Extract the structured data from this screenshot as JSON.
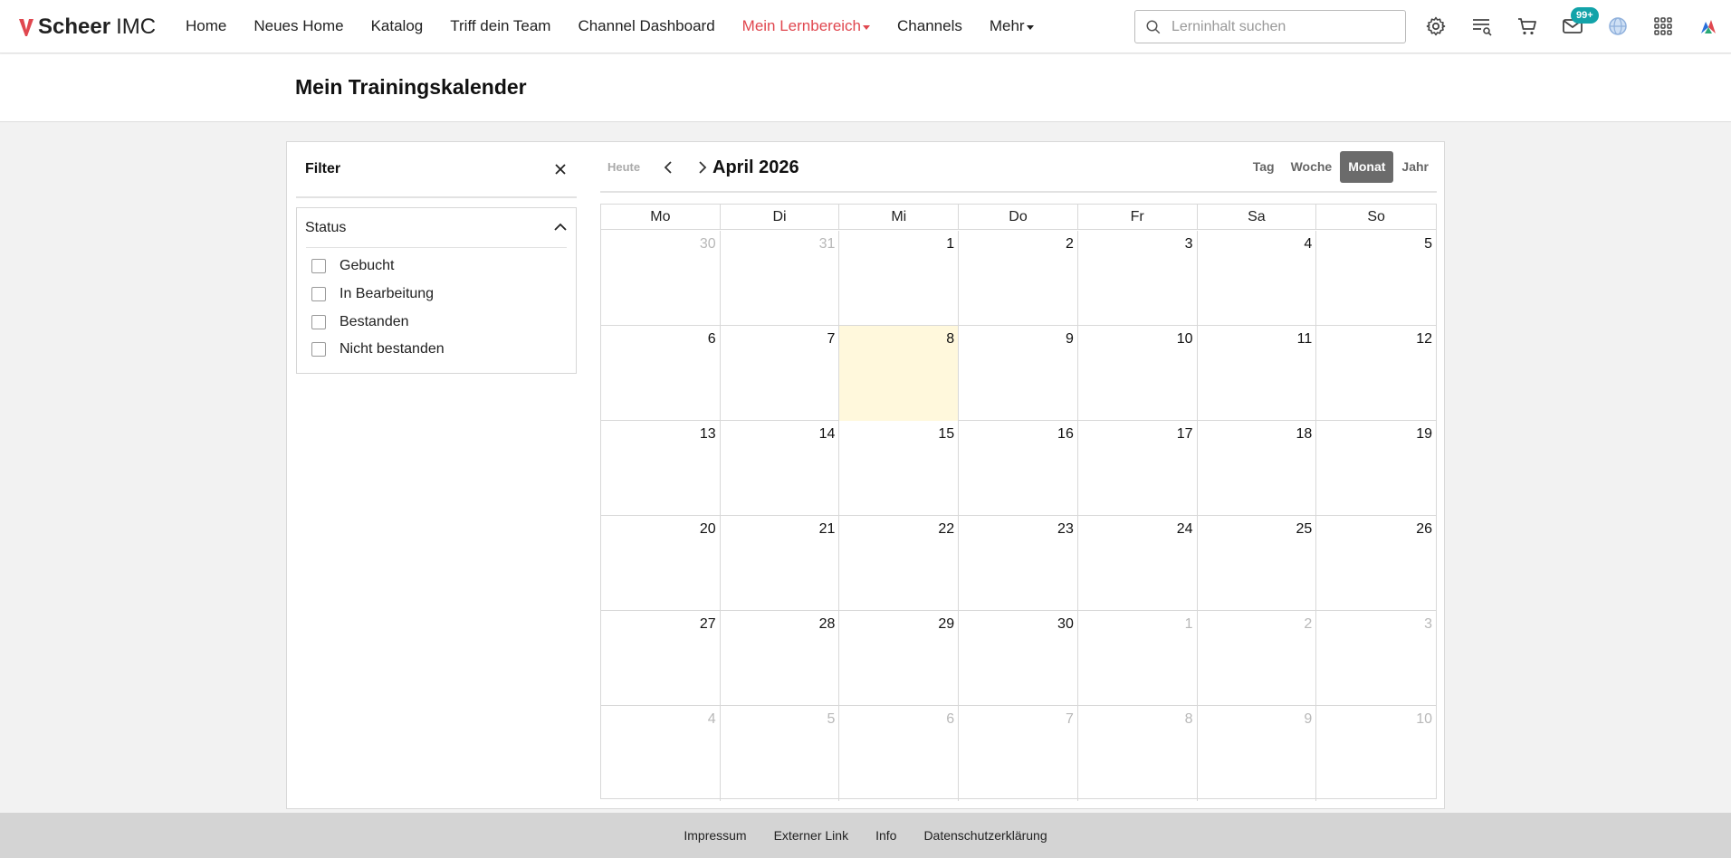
{
  "brand": {
    "name_bold": "Scheer",
    "name_light": "IMC"
  },
  "nav": {
    "items": [
      {
        "label": "Home",
        "active": false,
        "dropdown": false
      },
      {
        "label": "Neues Home",
        "active": false,
        "dropdown": false
      },
      {
        "label": "Katalog",
        "active": false,
        "dropdown": false
      },
      {
        "label": "Triff dein Team",
        "active": false,
        "dropdown": false
      },
      {
        "label": "Channel Dashboard",
        "active": false,
        "dropdown": false
      },
      {
        "label": "Mein Lernbereich",
        "active": true,
        "dropdown": true
      },
      {
        "label": "Channels",
        "active": false,
        "dropdown": false
      },
      {
        "label": "Mehr",
        "active": false,
        "dropdown": true
      }
    ]
  },
  "search": {
    "placeholder": "Lerninhalt suchen",
    "value": ""
  },
  "toolbar": {
    "icons": [
      "gear-icon",
      "list-search-icon",
      "cart-icon",
      "mail-icon",
      "globe-icon",
      "apps-grid-icon",
      "profile-logo-icon"
    ],
    "mail_badge": "99+"
  },
  "page": {
    "title": "Mein Trainingskalender"
  },
  "filter": {
    "title": "Filter",
    "status_label": "Status",
    "options": [
      {
        "label": "Gebucht",
        "checked": false
      },
      {
        "label": "In Bearbeitung",
        "checked": false
      },
      {
        "label": "Bestanden",
        "checked": false
      },
      {
        "label": "Nicht bestanden",
        "checked": false
      }
    ]
  },
  "calendar": {
    "today_label": "Heute",
    "month_title": "April 2026",
    "views": [
      {
        "label": "Tag",
        "active": false
      },
      {
        "label": "Woche",
        "active": false
      },
      {
        "label": "Monat",
        "active": true
      },
      {
        "label": "Jahr",
        "active": false
      }
    ],
    "weekdays": [
      "Mo",
      "Di",
      "Mi",
      "Do",
      "Fr",
      "Sa",
      "So"
    ],
    "weeks": [
      [
        {
          "d": "30",
          "other": true
        },
        {
          "d": "31",
          "other": true
        },
        {
          "d": "1"
        },
        {
          "d": "2"
        },
        {
          "d": "3"
        },
        {
          "d": "4"
        },
        {
          "d": "5"
        }
      ],
      [
        {
          "d": "6"
        },
        {
          "d": "7"
        },
        {
          "d": "8",
          "today": true
        },
        {
          "d": "9"
        },
        {
          "d": "10"
        },
        {
          "d": "11"
        },
        {
          "d": "12"
        }
      ],
      [
        {
          "d": "13"
        },
        {
          "d": "14"
        },
        {
          "d": "15"
        },
        {
          "d": "16"
        },
        {
          "d": "17"
        },
        {
          "d": "18"
        },
        {
          "d": "19"
        }
      ],
      [
        {
          "d": "20"
        },
        {
          "d": "21"
        },
        {
          "d": "22"
        },
        {
          "d": "23"
        },
        {
          "d": "24"
        },
        {
          "d": "25"
        },
        {
          "d": "26"
        }
      ],
      [
        {
          "d": "27"
        },
        {
          "d": "28"
        },
        {
          "d": "29"
        },
        {
          "d": "30"
        },
        {
          "d": "1",
          "other": true
        },
        {
          "d": "2",
          "other": true
        },
        {
          "d": "3",
          "other": true
        }
      ],
      [
        {
          "d": "4",
          "other": true
        },
        {
          "d": "5",
          "other": true
        },
        {
          "d": "6",
          "other": true
        },
        {
          "d": "7",
          "other": true
        },
        {
          "d": "8",
          "other": true
        },
        {
          "d": "9",
          "other": true
        },
        {
          "d": "10",
          "other": true
        }
      ]
    ]
  },
  "footer": {
    "links": [
      "Impressum",
      "Externer Link",
      "Info",
      "Datenschutzerklärung"
    ]
  },
  "colors": {
    "accent": "#e0474f",
    "badge": "#12a3a9",
    "today_bg": "#fff8dc",
    "active_view": "#6b6b6b"
  }
}
